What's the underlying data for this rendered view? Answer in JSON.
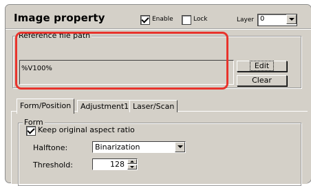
{
  "header": {
    "title": "Image property",
    "enable_label": "Enable",
    "enable_checked": true,
    "lock_label": "Lock",
    "lock_checked": false,
    "layer_label": "Layer",
    "layer_value": "0"
  },
  "reference": {
    "group_title": "Reference file path",
    "path_value": "%V100%",
    "edit_label": "Edit",
    "clear_label": "Clear"
  },
  "tabs": [
    {
      "label": "Form/Position",
      "active": true
    },
    {
      "label": "Adjustment1",
      "active": false
    },
    {
      "label": "Laser/Scan",
      "active": false
    }
  ],
  "form": {
    "group_title": "Form",
    "keep_aspect_label": "Keep original aspect ratio",
    "keep_aspect_checked": true,
    "halftone_label": "Halftone:",
    "halftone_value": "Binarization",
    "threshold_label": "Threshold:",
    "threshold_value": "128"
  },
  "colors": {
    "panel_bg": "#d4d0c8",
    "highlight": "#e8332c"
  }
}
